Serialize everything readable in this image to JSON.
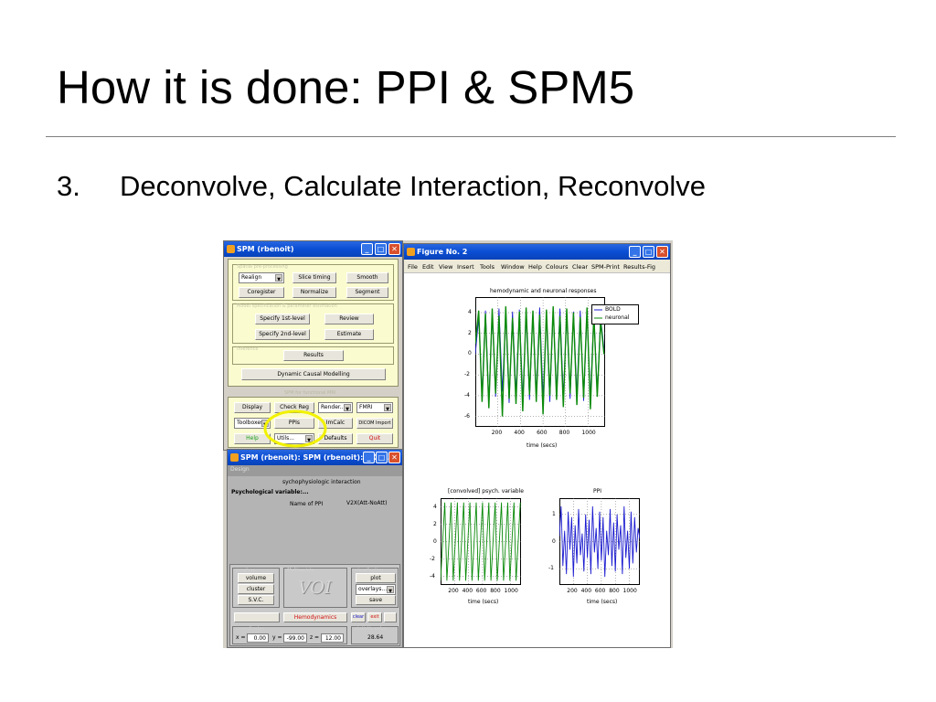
{
  "slide": {
    "title": "How it is done: PPI & SPM5",
    "bullet_number": "3.",
    "bullet_text": "Deconvolve, Calculate Interaction, Reconvolve"
  },
  "spm_menu_window": {
    "title": "SPM (rbenoit)",
    "realign_popup": "Realign",
    "buttons": {
      "slice_timing": "Slice timing",
      "smooth": "Smooth",
      "coregister": "Coregister",
      "normalize": "Normalize",
      "segment": "Segment",
      "specify_1st": "Specify 1st-level",
      "review": "Review",
      "specify_2nd": "Specify 2nd-level",
      "estimate": "Estimate",
      "results": "Results",
      "dcm": "Dynamic Causal Modelling",
      "display": "Display",
      "check_reg": "Check Reg",
      "render_popup": "Render...",
      "fmri_popup": "FMRI",
      "toolboxes_popup": "Toolboxes",
      "ppis": "PPIs",
      "imcalc": "ImCalc",
      "dicom_import": "DICOM Import",
      "help": "Help",
      "utils_popup": "Utils...",
      "defaults": "Defaults",
      "quit": "Quit"
    },
    "footer_label": "SPM for functional MRI"
  },
  "voi_window": {
    "title": "SPM (rbenoit): SPM (rbenoit): VOI...",
    "design_label": "Design",
    "heading": "sychophysiologic interaction",
    "psych_variable": "Psychological variable:...",
    "name_label": "Name of PPI",
    "name_value": "V2X(Att-NoAtt)",
    "buttons": {
      "volume": "volume",
      "cluster": "cluster",
      "svc": "S.V.C.",
      "plot": "plot",
      "overlays_popup": "overlays...",
      "save": "save",
      "hemodynamics": "Hemodynamics",
      "clear": "clear",
      "exit": "exit"
    },
    "voi_logo": "VOI",
    "coords": {
      "x_label": "x =",
      "x": "0.00",
      "y_label": "y =",
      "y": "-99.00",
      "z_label": "z =",
      "z": "12.00",
      "statistic": "28.64"
    }
  },
  "figure_window": {
    "title": "Figure No. 2",
    "menu": [
      "File",
      "Edit",
      "View",
      "Insert",
      "Tools",
      "Window",
      "Help",
      "Colours",
      "Clear",
      "SPM-Print",
      "Results-Fig"
    ]
  },
  "colors": {
    "bold": "#1b1bd0",
    "neuronal": "#0a8a0a",
    "ppi_line": "#1b1bd0",
    "highlight_circle": "#f2f200",
    "spm_panel": "#fbfbd0"
  },
  "chart_data": [
    {
      "type": "line",
      "title": "hemodynamic and neuronal responses",
      "xlabel": "time (secs)",
      "ylabel": "",
      "xticks": [
        200,
        400,
        600,
        800,
        1000
      ],
      "yticks": [
        4,
        2,
        0,
        -2,
        -4,
        -6
      ],
      "xlim": [
        0,
        1150
      ],
      "ylim": [
        -7,
        5.5
      ],
      "legend_position": "top-right",
      "series": [
        {
          "name": "BOLD",
          "x": [
            0,
            30,
            60,
            90,
            120,
            150,
            180,
            210,
            240,
            270,
            300,
            330,
            360,
            390,
            420,
            450,
            480,
            510,
            540,
            570,
            600,
            630,
            660,
            690,
            720,
            750,
            780,
            810,
            840,
            870,
            900,
            930,
            960,
            990,
            1020,
            1050,
            1080,
            1110,
            1140
          ],
          "y": [
            0,
            3.5,
            -3.8,
            4.2,
            -4.5,
            3.9,
            -4.1,
            4.4,
            -3.6,
            3.8,
            -4.7,
            4.1,
            -3.9,
            4.3,
            -4.2,
            3.7,
            -4.4,
            4.0,
            -3.8,
            4.5,
            -4.1,
            3.6,
            -4.6,
            4.2,
            -3.7,
            4.4,
            -4.0,
            3.9,
            -4.3,
            4.1,
            -3.9,
            4.2,
            -4.5,
            3.8,
            -4.2,
            4.0,
            -3.6,
            3.5,
            0.5
          ]
        },
        {
          "name": "neuronal",
          "x": [
            0,
            30,
            60,
            90,
            120,
            150,
            180,
            210,
            240,
            270,
            300,
            330,
            360,
            390,
            420,
            450,
            480,
            510,
            540,
            570,
            600,
            630,
            660,
            690,
            720,
            750,
            780,
            810,
            840,
            870,
            900,
            930,
            960,
            990,
            1020,
            1050,
            1080,
            1110,
            1140
          ],
          "y": [
            1,
            4.2,
            -4.6,
            3.9,
            -5.2,
            4.4,
            -3.8,
            3.7,
            -6.0,
            4.6,
            -4.3,
            3.5,
            -4.8,
            4.1,
            -5.5,
            4.5,
            -3.9,
            4.2,
            -4.6,
            3.8,
            -5.8,
            4.3,
            -4.0,
            4.6,
            -4.4,
            3.7,
            -5.1,
            4.4,
            -3.8,
            4.0,
            -4.9,
            3.6,
            -4.2,
            4.5,
            -5.3,
            3.8,
            -4.1,
            3.2,
            0
          ]
        }
      ]
    },
    {
      "type": "line",
      "title": "[convolved] psych. variable",
      "xlabel": "time (secs)",
      "xticks": [
        200,
        400,
        600,
        800,
        1000
      ],
      "yticks": [
        4,
        2,
        0,
        -2,
        -4
      ],
      "xlim": [
        0,
        1150
      ],
      "ylim": [
        -5,
        5
      ],
      "series": [
        {
          "name": "",
          "x": [
            0,
            60,
            90,
            150,
            180,
            240,
            270,
            330,
            360,
            420,
            450,
            510,
            540,
            600,
            630,
            690,
            720,
            780,
            810,
            870,
            900,
            960,
            990,
            1050,
            1080,
            1140
          ],
          "y": [
            -4.5,
            4.5,
            -4.5,
            4.5,
            -4.5,
            4.5,
            -4.5,
            4.5,
            -4.5,
            4.5,
            -4.5,
            4.5,
            -4.5,
            4.5,
            -4.5,
            4.5,
            -4.5,
            4.5,
            -4.5,
            4.5,
            -4.5,
            4.5,
            -4.5,
            4.5,
            -4.5,
            4.5
          ]
        }
      ]
    },
    {
      "type": "line",
      "title": "PPI",
      "xlabel": "time (secs)",
      "xticks": [
        200,
        400,
        600,
        800,
        1000
      ],
      "yticks": [
        1,
        0,
        -1
      ],
      "xlim": [
        0,
        1150
      ],
      "ylim": [
        -1.6,
        1.6
      ],
      "series": [
        {
          "name": "",
          "x": [
            0,
            25,
            50,
            75,
            100,
            125,
            150,
            175,
            200,
            225,
            250,
            275,
            300,
            325,
            350,
            375,
            400,
            425,
            450,
            475,
            500,
            525,
            550,
            575,
            600,
            625,
            650,
            675,
            700,
            725,
            750,
            775,
            800,
            825,
            850,
            875,
            900,
            925,
            950,
            975,
            1000,
            1025,
            1050,
            1075,
            1100,
            1125,
            1150
          ],
          "y": [
            0.2,
            1.3,
            -0.9,
            0.4,
            -1.2,
            1.1,
            -0.3,
            0.9,
            -1.3,
            0.6,
            -0.8,
            1.2,
            -0.5,
            0.3,
            -1.1,
            1.0,
            -0.6,
            0.8,
            -1.2,
            1.3,
            -0.4,
            0.5,
            -1.0,
            1.1,
            -0.7,
            0.9,
            -1.3,
            0.4,
            -0.5,
            1.2,
            -0.9,
            0.7,
            -1.1,
            1.0,
            -0.3,
            0.6,
            -1.2,
            1.3,
            -0.6,
            0.4,
            -1.0,
            1.1,
            -0.8,
            0.9,
            -0.4,
            0.5,
            0.1
          ]
        }
      ]
    }
  ]
}
